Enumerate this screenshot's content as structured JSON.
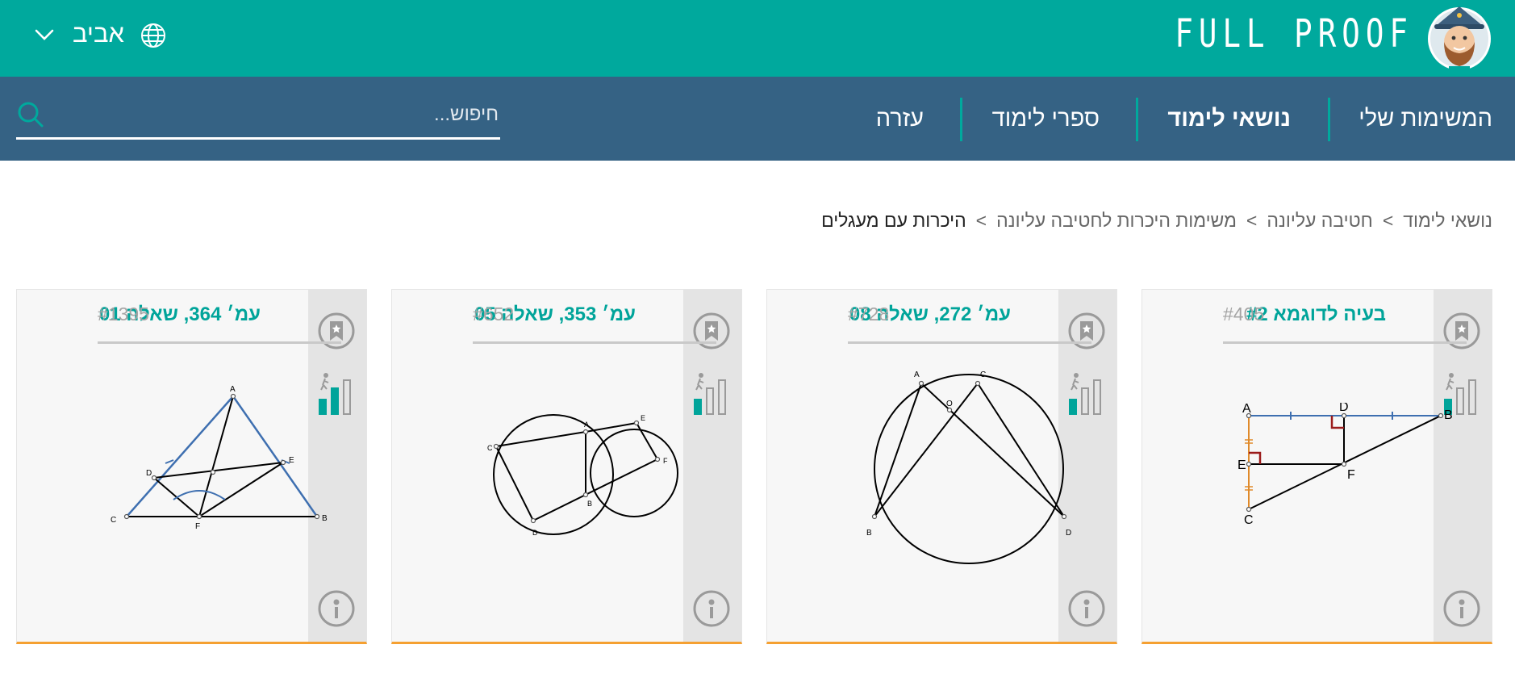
{
  "header": {
    "logo_text": "FULL PROOF",
    "language_label": "אביב",
    "brand_color": "#00a99d"
  },
  "nav": {
    "items": [
      {
        "label": "המשימות שלי"
      },
      {
        "label": "נושאי לימוד",
        "active": true
      },
      {
        "label": "ספרי לימוד"
      },
      {
        "label": "עזרה"
      }
    ],
    "background_color": "#356284"
  },
  "search": {
    "placeholder": "חיפוש..."
  },
  "breadcrumb": {
    "items": [
      "נושאי לימוד",
      "חטיבה עליונה",
      "משימות היכרות לחטיבה עליונה",
      "היכרות עם מעגלים"
    ],
    "separator": ">"
  },
  "cards": [
    {
      "title": "בעיה לדוגמא #2",
      "number": "#405",
      "difficulty_level": 1,
      "figure_labels": [
        "A",
        "D",
        "B",
        "E",
        "F",
        "C"
      ]
    },
    {
      "title": "עמ׳ 272, שאלה 08",
      "number": "#728",
      "difficulty_level": 1,
      "figure_labels": [
        "A",
        "C",
        "O",
        "B",
        "D"
      ]
    },
    {
      "title": "עמ׳ 353, שאלה 05",
      "number": "#652",
      "difficulty_level": 1,
      "figure_labels": [
        "A",
        "E",
        "C",
        "F",
        "B",
        "D"
      ]
    },
    {
      "title": "עמ׳ 364, שאלה 01",
      "number": "#1395",
      "difficulty_level": 2,
      "figure_labels": [
        "A",
        "D",
        "E",
        "C",
        "F",
        "B"
      ]
    }
  ],
  "colors": {
    "accent_teal": "#00a49a",
    "card_bottom_border": "#f5a031",
    "figure_blue": "#3e6fb0",
    "figure_orange": "#e08a2a",
    "figure_red": "#9b1b1b"
  }
}
